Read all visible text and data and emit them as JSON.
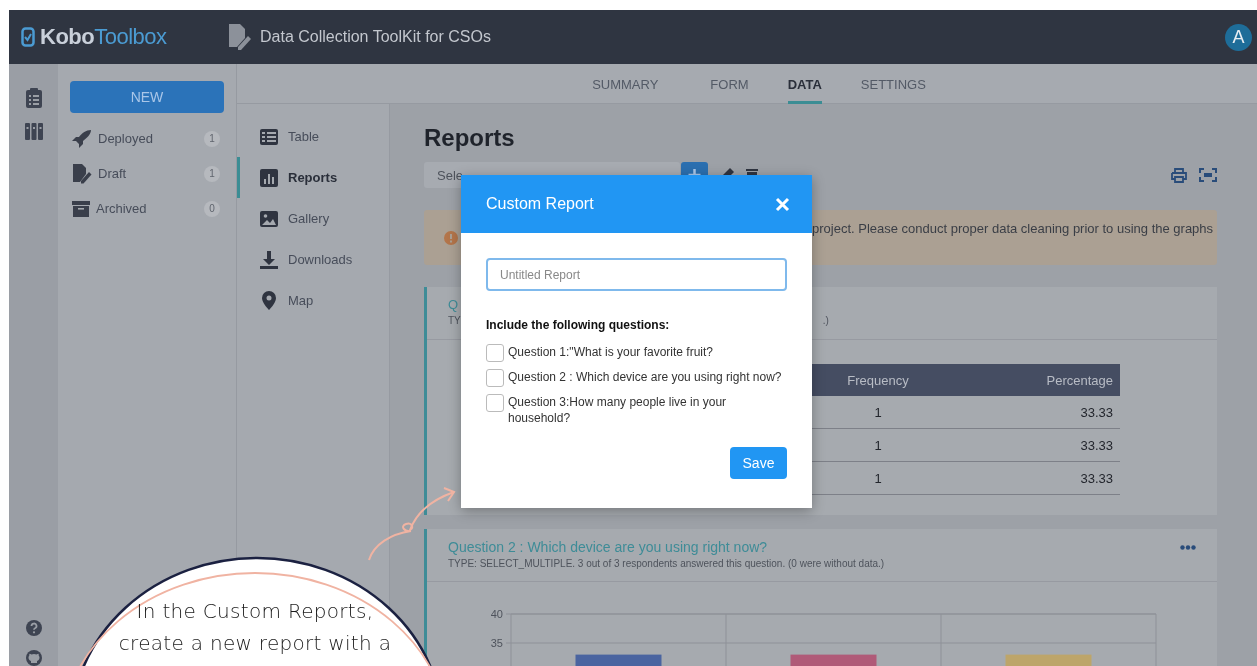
{
  "topbar": {
    "logo_parts": [
      "Kobo",
      "Toolbox"
    ],
    "project_title": "Data Collection ToolKit for CSOs",
    "avatar": "A"
  },
  "tabs": [
    {
      "label": "SUMMARY",
      "selected": false
    },
    {
      "label": "FORM",
      "selected": false
    },
    {
      "label": "DATA",
      "selected": true
    },
    {
      "label": "SETTINGS",
      "selected": false
    }
  ],
  "sidebar": {
    "new_button": "NEW",
    "items": [
      {
        "kind": "deployed",
        "label": "Deployed",
        "count": "1"
      },
      {
        "kind": "draft",
        "label": "Draft",
        "count": "1"
      },
      {
        "kind": "archived",
        "label": "Archived",
        "count": "0"
      }
    ]
  },
  "subnav": [
    {
      "kind": "table",
      "label": "Table",
      "selected": false
    },
    {
      "kind": "reports",
      "label": "Reports",
      "selected": true
    },
    {
      "kind": "gallery",
      "label": "Gallery",
      "selected": false
    },
    {
      "kind": "downloads",
      "label": "Downloads",
      "selected": false
    },
    {
      "kind": "map",
      "label": "Map",
      "selected": false
    }
  ],
  "reports": {
    "heading": "Reports",
    "select_value": "Sele",
    "warning": "project. Please conduct proper data cleaning prior to using the graphs",
    "question_1": {
      "title": "Q",
      "type_line": "TY",
      "type_line_end": ".)",
      "table": {
        "columns": [
          "Frequency",
          "Percentage"
        ],
        "rows": [
          [
            "1",
            "33.33"
          ],
          [
            "1",
            "33.33"
          ],
          [
            "1",
            "33.33"
          ]
        ]
      }
    },
    "question_2": {
      "title": "Question 2 : Which device are you using right now?",
      "type_line": "TYPE: SELECT_MULTIPLE. 3 out of 3 respondents answered this question. (0 were without data.)",
      "chart_data": {
        "type": "bar",
        "ylim": [
          0,
          40
        ],
        "yticks": [
          35,
          40
        ],
        "series": [
          {
            "color": "#4a64a0",
            "values": [
              33,
              null,
              null
            ]
          },
          {
            "color": "#b05a78",
            "values": [
              null,
              33,
              null
            ]
          },
          {
            "color": "#bda56a",
            "values": [
              null,
              null,
              33
            ]
          }
        ]
      }
    }
  },
  "modal": {
    "title": "Custom Report",
    "name_field": {
      "placeholder": "Untitled Report"
    },
    "questions_label": "Include the following questions:",
    "questions": [
      {
        "label": "Question 1:\"What is your favorite fruit?",
        "checked": false
      },
      {
        "label": "Question 2 : Which device are you using right now?",
        "checked": false
      },
      {
        "label": "Question 3:How many people live in your household?",
        "checked": false
      }
    ],
    "save_button": "Save"
  },
  "annotation": {
    "lines": [
      "In the Custom Reports,",
      "create a new report with a"
    ]
  }
}
